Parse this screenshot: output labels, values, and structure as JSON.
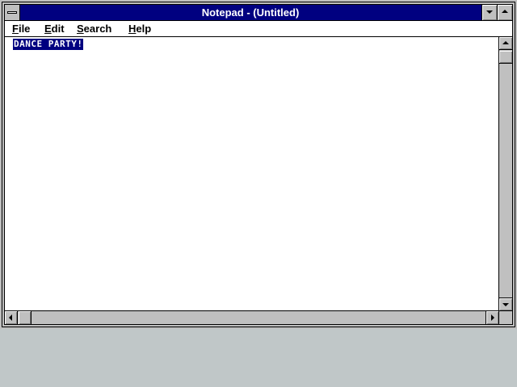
{
  "window": {
    "title": "Notepad - (Untitled)"
  },
  "menu": {
    "items": [
      {
        "key": "F",
        "rest": "ile"
      },
      {
        "key": "E",
        "rest": "dit"
      },
      {
        "key": "S",
        "rest": "earch"
      },
      {
        "key": "H",
        "rest": "elp"
      }
    ]
  },
  "editor": {
    "selected_text": "DANCE PARTY!"
  },
  "icons": {
    "system_menu": "control-menu-icon",
    "minimize": "minimize-arrow-icon",
    "maximize": "maximize-arrow-icon",
    "scroll_up": "scroll-up-arrow-icon",
    "scroll_down": "scroll-down-arrow-icon",
    "scroll_left": "scroll-left-arrow-icon",
    "scroll_right": "scroll-right-arrow-icon"
  },
  "colors": {
    "titlebar": "#000080",
    "selection": "#000080",
    "desktop": "#c0c7c8",
    "chrome": "#c0c0c0"
  }
}
